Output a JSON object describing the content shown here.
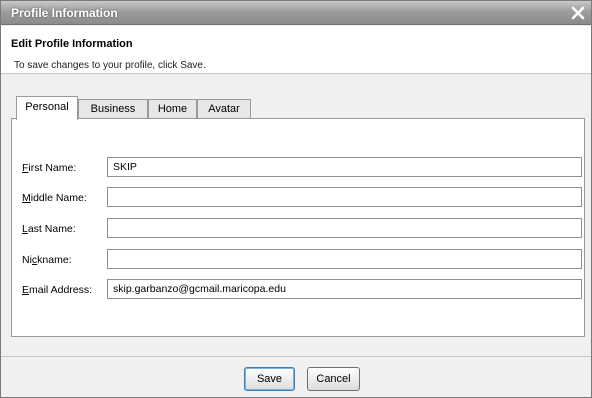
{
  "window": {
    "title": "Profile Information"
  },
  "header": {
    "title": "Edit Profile Information",
    "subtitle": "To save changes to your profile, click Save."
  },
  "tabs": [
    {
      "label": "Personal",
      "active": true
    },
    {
      "label": "Business",
      "active": false
    },
    {
      "label": "Home",
      "active": false
    },
    {
      "label": "Avatar",
      "active": false
    }
  ],
  "fields": [
    {
      "label_first": "F",
      "label_rest": "irst Name:",
      "value": "SKIP"
    },
    {
      "label_first": "M",
      "label_rest": "iddle Name:",
      "value": ""
    },
    {
      "label_first": "L",
      "label_rest": "ast Name:",
      "value": ""
    },
    {
      "label_pre": "Ni",
      "label_u": "c",
      "label_rest": "kname:",
      "value": ""
    },
    {
      "label_first": "E",
      "label_rest": "mail Address:",
      "value": "skip.garbanzo@gcmail.maricopa.edu"
    }
  ],
  "buttons": {
    "save": "Save",
    "cancel": "Cancel"
  },
  "colors": {
    "titlebar": "#9e9e9e",
    "panel": "#ffffff",
    "dialog": "#f0f0f0"
  },
  "icons": {
    "close": "close-icon"
  }
}
